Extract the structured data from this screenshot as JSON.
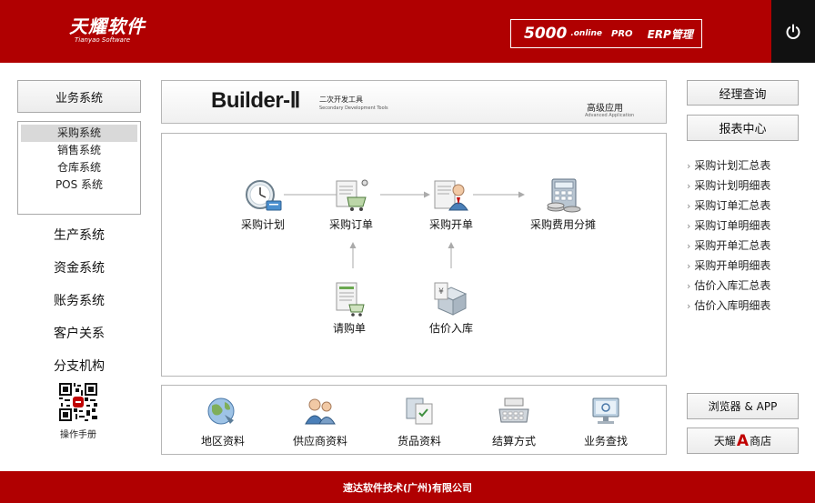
{
  "header": {
    "logo_text": "天耀软件",
    "logo_sub": "Tianyao Software",
    "product_num": "5000",
    "product_online": ".online",
    "product_pro": "PRO",
    "product_erp": "ERP管理",
    "power_icon": "power-icon"
  },
  "left": {
    "business_btn": "业务系统",
    "submenu": [
      "采购系统",
      "销售系统",
      "仓库系统",
      "POS 系统"
    ],
    "submenu_selected": 0,
    "menu": [
      "生产系统",
      "资金系统",
      "账务系统",
      "客户关系",
      "分支机构"
    ],
    "qr_label": "操作手册"
  },
  "banner": {
    "title": "Builder-Ⅱ",
    "cn": "二次开发工具",
    "en": "Secondary Development Tools",
    "adv_cn": "高级应用",
    "adv_en": "Advanced Application"
  },
  "flow": {
    "nodes": {
      "plan": "采购计划",
      "order": "采购订单",
      "bill": "采购开单",
      "cost": "采购费用分摊",
      "request": "请购单",
      "estimate": "估价入库"
    }
  },
  "tools": [
    "地区资料",
    "供应商资料",
    "货品资料",
    "结算方式",
    "业务查找"
  ],
  "right": {
    "manager_btn": "经理查询",
    "report_btn": "报表中心",
    "reports": [
      "采购计划汇总表",
      "采购计划明细表",
      "采购订单汇总表",
      "采购订单明细表",
      "采购开单汇总表",
      "采购开单明细表",
      "估价入库汇总表",
      "估价入库明细表"
    ],
    "browser_btn": "浏览器 & APP",
    "store_pre": "天耀",
    "store_a": "A",
    "store_post": "商店"
  },
  "footer": {
    "text": "速达软件技术(广州)有限公司"
  },
  "colors": {
    "brand_red": "#b00001",
    "power_bg": "#111111"
  }
}
